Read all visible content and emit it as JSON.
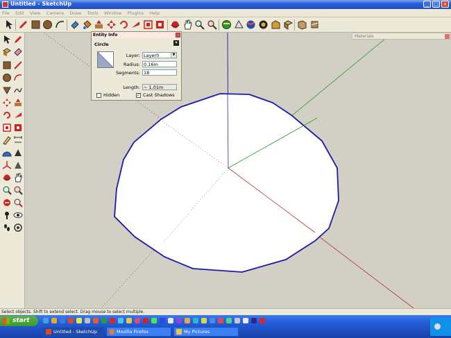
{
  "window": {
    "title": "Untitled - SketchUp",
    "controls": {
      "minimize": "_",
      "maximize": "□",
      "close": "×"
    }
  },
  "menu": [
    "File",
    "Edit",
    "View",
    "Camera",
    "Draw",
    "Tools",
    "Window",
    "Plugins",
    "Help"
  ],
  "entity_info": {
    "title": "Entity Info",
    "type": "Circle",
    "layer_label": "Layer:",
    "layer_value": "Layer0",
    "radius_label": "Radius:",
    "radius_value": "0.16m",
    "segments_label": "Segments:",
    "segments_value": "18",
    "length_label": "Length:",
    "length_value": "~ 1.01m",
    "hidden_label": "Hidden",
    "hidden_checked": false,
    "cast_shadows_label": "Cast Shadows",
    "cast_shadows_checked": true,
    "expand_glyph": "▾"
  },
  "materials": {
    "title": "Materials"
  },
  "status": {
    "text": "Select objects. Shift to extend select. Drag mouse to select multiple."
  },
  "taskbar": {
    "start_label": "start",
    "tasks": [
      {
        "label": "Untitled - SketchUp",
        "active": true
      },
      {
        "label": "Mozilla Firefox",
        "active": false
      },
      {
        "label": "My Pictures",
        "active": false
      }
    ]
  },
  "colors": {
    "circle_edge": "#1a1aa8",
    "axis_red": "#b03030",
    "axis_green": "#2a9a2a",
    "axis_blue": "#2a2ab0",
    "viewport_bg": "#d2d0c4"
  }
}
